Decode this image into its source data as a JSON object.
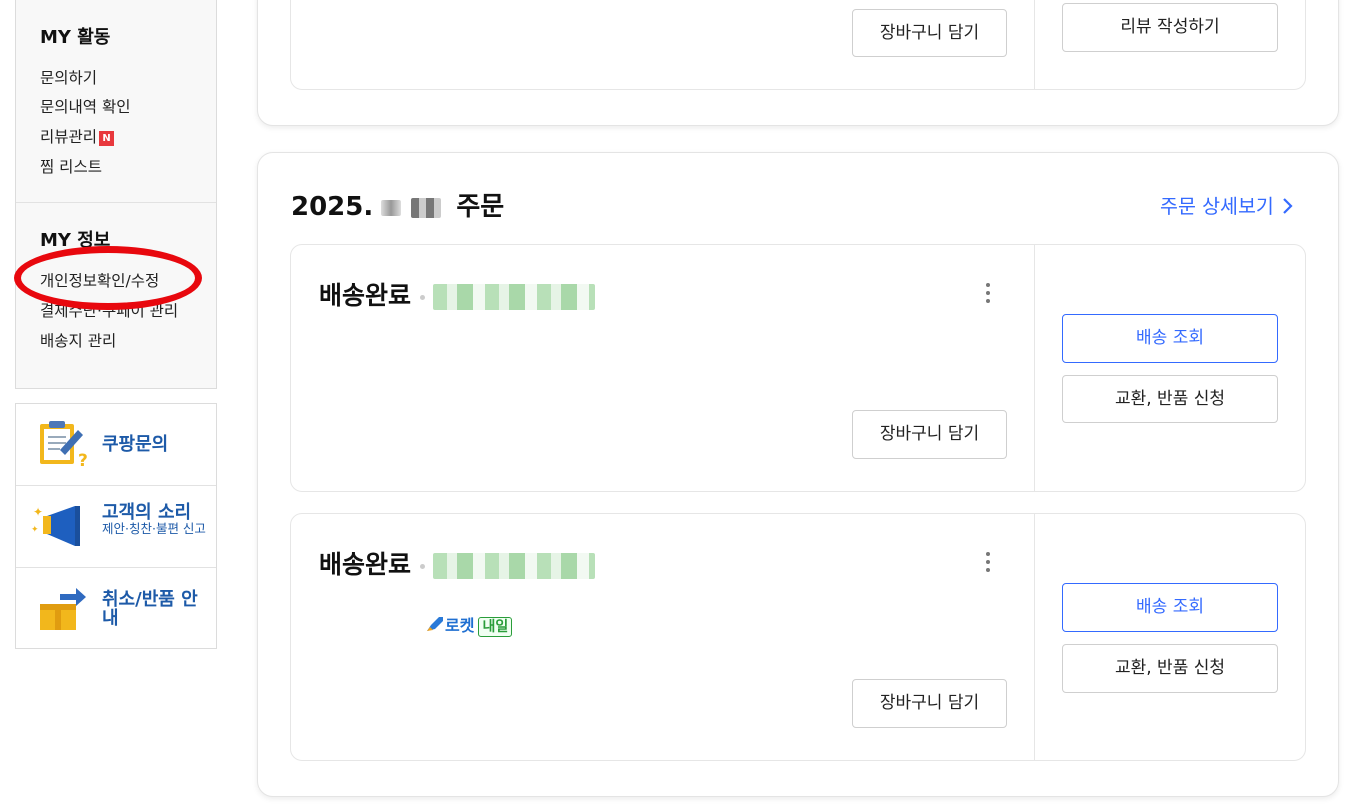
{
  "sidebar": {
    "my_activity": {
      "heading": "MY 활동",
      "links": [
        "문의하기",
        "문의내역 확인",
        "리뷰관리",
        "찜 리스트"
      ],
      "new_badge": "N"
    },
    "my_info": {
      "heading": "MY 정보",
      "links": [
        "개인정보확인/수정",
        "결제수단·쿠페이 관리",
        "배송지 관리"
      ]
    },
    "quick_links": [
      {
        "title": "쿠팡문의",
        "subtitle": "",
        "icon": "clipboard-question-icon"
      },
      {
        "title": "고객의 소리",
        "subtitle": "제안·칭찬·불편 신고",
        "icon": "megaphone-icon"
      },
      {
        "title": "취소/반품 안내",
        "subtitle": "",
        "icon": "return-box-icon"
      }
    ]
  },
  "previous_order": {
    "add_to_cart": "장바구니 담기",
    "write_review": "리뷰 작성하기"
  },
  "order": {
    "date_prefix": "2025.",
    "date_suffix": "주문",
    "detail_link": "주문 상세보기",
    "items": [
      {
        "status": "배송완료",
        "add_to_cart": "장바구니 담기",
        "track": "배송 조회",
        "exchange": "교환, 반품 신청",
        "badge": ""
      },
      {
        "status": "배송완료",
        "add_to_cart": "장바구니 담기",
        "track": "배송 조회",
        "exchange": "교환, 반품 신청",
        "badge": "로켓",
        "badge_box": "내일"
      }
    ]
  },
  "colors": {
    "accent_blue": "#346aff",
    "highlight_red": "#e8080e",
    "sidebar_blue": "#1d5aa8"
  }
}
